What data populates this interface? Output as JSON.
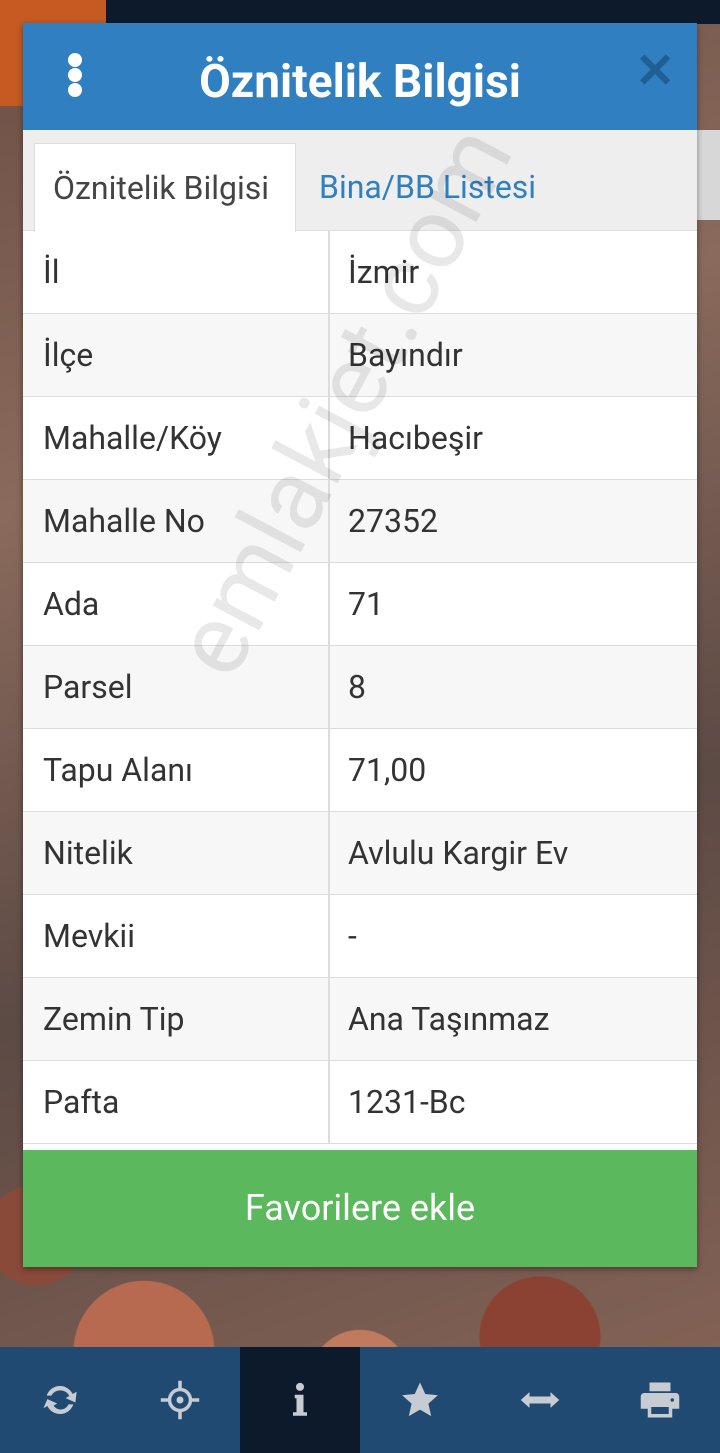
{
  "dialog": {
    "title": "Öznitelik Bilgisi",
    "tabs": [
      {
        "label": "Öznitelik Bilgisi",
        "active": true
      },
      {
        "label": "Bina/BB Listesi",
        "active": false
      }
    ],
    "rows": [
      {
        "key": "İl",
        "value": "İzmir"
      },
      {
        "key": "İlçe",
        "value": "Bayındır"
      },
      {
        "key": "Mahalle/Köy",
        "value": "Hacıbeşir"
      },
      {
        "key": "Mahalle No",
        "value": "27352"
      },
      {
        "key": "Ada",
        "value": "71"
      },
      {
        "key": "Parsel",
        "value": "8"
      },
      {
        "key": "Tapu Alanı",
        "value": "71,00"
      },
      {
        "key": "Nitelik",
        "value": "Avlulu Kargir Ev"
      },
      {
        "key": "Mevkii",
        "value": "-"
      },
      {
        "key": "Zemin Tip",
        "value": "Ana Taşınmaz"
      },
      {
        "key": "Pafta",
        "value": "1231-Bc"
      }
    ],
    "favorite_button": "Favorilere ekle"
  },
  "watermark": "emlakjet.com",
  "toolbar": [
    {
      "icon": "refresh-icon"
    },
    {
      "icon": "crosshair-icon"
    },
    {
      "icon": "info-icon",
      "active": true
    },
    {
      "icon": "star-icon"
    },
    {
      "icon": "measure-icon"
    },
    {
      "icon": "print-icon"
    }
  ],
  "colors": {
    "header": "#2f7fc1",
    "button": "#5cb85c",
    "toolbar": "#214a73",
    "toolbar_active": "#0c1a2c"
  }
}
